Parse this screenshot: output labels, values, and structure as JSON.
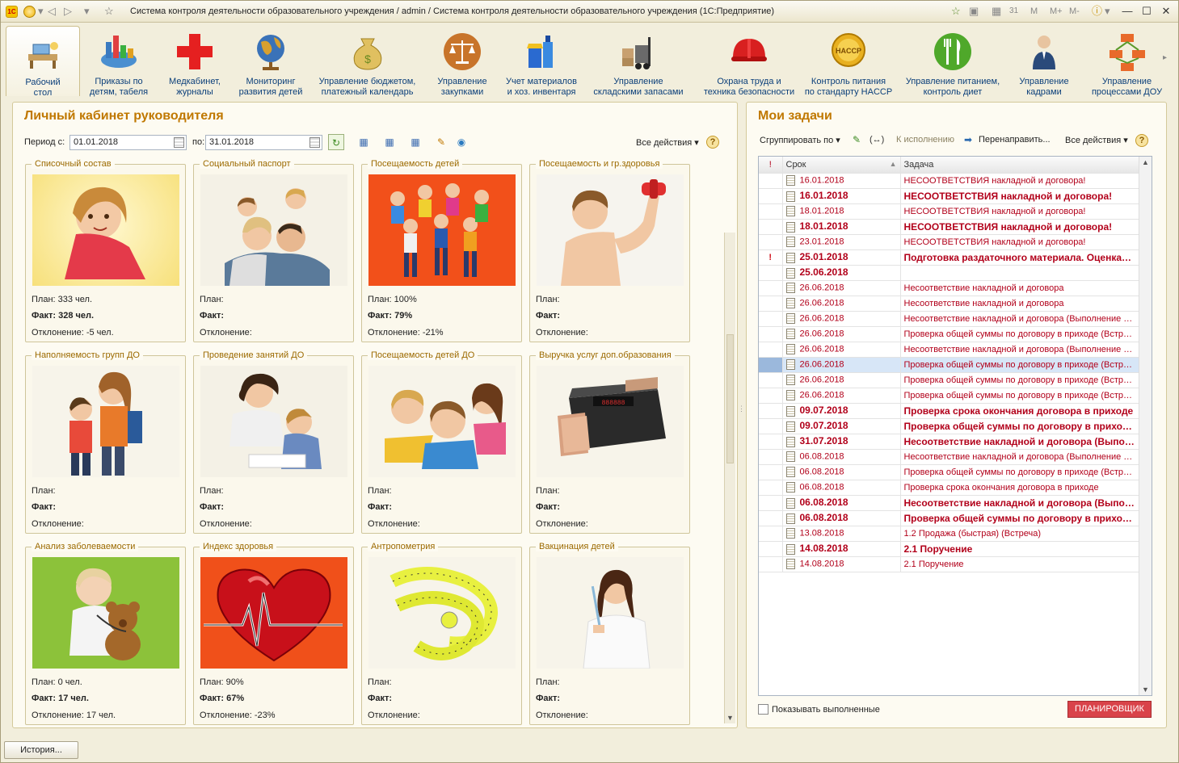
{
  "window": {
    "title": "Система контроля деятельности образовательного учреждения / admin / Система контроля деятельности образовательного учреждения  (1С:Предприятие)",
    "logo": "1С"
  },
  "toolbar": [
    {
      "label1": "Рабочий",
      "label2": "стол",
      "icon": "desk-icon"
    },
    {
      "label1": "Приказы по",
      "label2": "детям, табеля",
      "icon": "chart-icon"
    },
    {
      "label1": "Медкабинет,",
      "label2": "журналы",
      "icon": "red-cross-icon"
    },
    {
      "label1": "Мониторинг",
      "label2": "развития детей",
      "icon": "globe-icon"
    },
    {
      "label1": "Управление бюджетом,",
      "label2": "платежный календарь",
      "icon": "money-bag-icon"
    },
    {
      "label1": "Управление",
      "label2": "закупками",
      "icon": "scales-icon"
    },
    {
      "label1": "Учет материалов",
      "label2": "и хоз. инвентаря",
      "icon": "cleaning-icon"
    },
    {
      "label1": "Управление",
      "label2": "складскими запасами",
      "icon": "forklift-icon"
    },
    {
      "label1": "Охрана труда и",
      "label2": "техника безопасности",
      "icon": "helmet-icon"
    },
    {
      "label1": "Контроль питания",
      "label2": "по стандарту HACCP",
      "icon": "haccp-badge-icon",
      "badge": "HACCP"
    },
    {
      "label1": "Управление питанием,",
      "label2": "контроль диет",
      "icon": "fork-knife-icon"
    },
    {
      "label1": "Управление",
      "label2": "кадрами",
      "icon": "person-icon"
    },
    {
      "label1": "Управление",
      "label2": "процессами ДОУ",
      "icon": "process-icon"
    }
  ],
  "left": {
    "title": "Личный кабинет руководителя",
    "period_from_label": "Период с:",
    "period_from": "01.01.2018",
    "period_to_label": "по:",
    "period_to": "31.01.2018",
    "actions_label": "Все действия",
    "help": "?"
  },
  "cards": [
    {
      "title": "Списочный состав",
      "plan": "План: 333 чел.",
      "fact": "Факт: 328 чел.",
      "dev": "Отклонение: -5 чел."
    },
    {
      "title": "Социальный паспорт",
      "plan": "План:",
      "fact": "Факт:",
      "dev": "Отклонение:"
    },
    {
      "title": "Посещаемость детей",
      "plan": "План: 100%",
      "fact": "Факт: 79%",
      "dev": "Отклонение: -21%"
    },
    {
      "title": "Посещаемость и гр.здоровья",
      "plan": "План:",
      "fact": "Факт:",
      "dev": "Отклонение:"
    },
    {
      "title": "Наполняемость групп ДО",
      "plan": "План:",
      "fact": "Факт:",
      "dev": "Отклонение:"
    },
    {
      "title": "Проведение занятий ДО",
      "plan": "План:",
      "fact": "Факт:",
      "dev": "Отклонение:"
    },
    {
      "title": "Посещаемость детей ДО",
      "plan": "План:",
      "fact": "Факт:",
      "dev": "Отклонение:"
    },
    {
      "title": "Выручка услуг доп.образования",
      "plan": "План:",
      "fact": "Факт:",
      "dev": "Отклонение:"
    },
    {
      "title": "Анализ заболеваемости",
      "plan": "План: 0 чел.",
      "fact": "Факт: 17 чел.",
      "dev": "Отклонение: 17 чел."
    },
    {
      "title": "Индекс здоровья",
      "plan": "План: 90%",
      "fact": "Факт: 67%",
      "dev": "Отклонение: -23%"
    },
    {
      "title": "Антропометрия",
      "plan": "План:",
      "fact": "Факт:",
      "dev": "Отклонение:"
    },
    {
      "title": "Вакцинация детей",
      "plan": "План:",
      "fact": "Факт:",
      "dev": "Отклонение:"
    }
  ],
  "right": {
    "title": "Мои задачи",
    "group_by": "Сгруппировать по",
    "to_execute": "К исполнению",
    "redirect": "Перенаправить...",
    "actions_label": "Все действия",
    "help": "?",
    "col_flag": "!",
    "col_date": "Срок",
    "col_task": "Задача",
    "show_done": "Показывать выполненные",
    "planner": "ПЛАНИРОВЩИК"
  },
  "tasks": [
    {
      "flag": "",
      "date": "16.01.2018",
      "task": "НЕСООТВЕТСТВИЯ накладной и договора!",
      "bold": false
    },
    {
      "flag": "",
      "date": "16.01.2018",
      "task": "НЕСООТВЕТСТВИЯ накладной и договора!",
      "bold": true
    },
    {
      "flag": "",
      "date": "18.01.2018",
      "task": "НЕСООТВЕТСТВИЯ накладной и договора!",
      "bold": false
    },
    {
      "flag": "",
      "date": "18.01.2018",
      "task": "НЕСООТВЕТСТВИЯ накладной и договора!",
      "bold": true
    },
    {
      "flag": "",
      "date": "23.01.2018",
      "task": "НЕСООТВЕТСТВИЯ накладной и договора!",
      "bold": false
    },
    {
      "flag": "!",
      "date": "25.01.2018",
      "task": "Подготовка раздаточного материала. Оценка…",
      "bold": true
    },
    {
      "flag": "",
      "date": "25.06.2018",
      "task": "",
      "bold": true
    },
    {
      "flag": "",
      "date": "26.06.2018",
      "task": "Несоответствие накладной и договора",
      "bold": false
    },
    {
      "flag": "",
      "date": "26.06.2018",
      "task": "Несоответствие накладной и договора",
      "bold": false
    },
    {
      "flag": "",
      "date": "26.06.2018",
      "task": "Несоответствие накладной и договора (Выполнение р…",
      "bold": false
    },
    {
      "flag": "",
      "date": "26.06.2018",
      "task": "Проверка общей суммы по договору в приходе (Встре…",
      "bold": false
    },
    {
      "flag": "",
      "date": "26.06.2018",
      "task": "Несоответствие накладной и договора (Выполнение р…",
      "bold": false
    },
    {
      "flag": "",
      "date": "26.06.2018",
      "task": "Проверка общей суммы по договору в приходе (Встре…",
      "bold": false,
      "selected": true
    },
    {
      "flag": "",
      "date": "26.06.2018",
      "task": "Проверка общей суммы по договору в приходе (Встре…",
      "bold": false
    },
    {
      "flag": "",
      "date": "26.06.2018",
      "task": "Проверка общей суммы по договору в приходе (Встре…",
      "bold": false
    },
    {
      "flag": "",
      "date": "09.07.2018",
      "task": "Проверка срока окончания договора в приходе",
      "bold": true
    },
    {
      "flag": "",
      "date": "09.07.2018",
      "task": "Проверка общей суммы по договору в прихо…",
      "bold": true
    },
    {
      "flag": "",
      "date": "31.07.2018",
      "task": "Несоответствие накладной и договора (Выпо…",
      "bold": true
    },
    {
      "flag": "",
      "date": "06.08.2018",
      "task": "Несоответствие накладной и договора (Выполнение р…",
      "bold": false
    },
    {
      "flag": "",
      "date": "06.08.2018",
      "task": "Проверка общей суммы по договору в приходе (Встре…",
      "bold": false
    },
    {
      "flag": "",
      "date": "06.08.2018",
      "task": "Проверка срока окончания договора в приходе",
      "bold": false
    },
    {
      "flag": "",
      "date": "06.08.2018",
      "task": "Несоответствие накладной и договора (Выпо…",
      "bold": true
    },
    {
      "flag": "",
      "date": "06.08.2018",
      "task": "Проверка общей суммы по договору в прихо…",
      "bold": true
    },
    {
      "flag": "",
      "date": "13.08.2018",
      "task": "1.2 Продажа (быстрая) (Встреча)",
      "bold": false
    },
    {
      "flag": "",
      "date": "14.08.2018",
      "task": "2.1 Поручение",
      "bold": true
    },
    {
      "flag": "",
      "date": "14.08.2018",
      "task": "2.1 Поручение",
      "bold": false
    }
  ],
  "footer": {
    "history": "История..."
  }
}
